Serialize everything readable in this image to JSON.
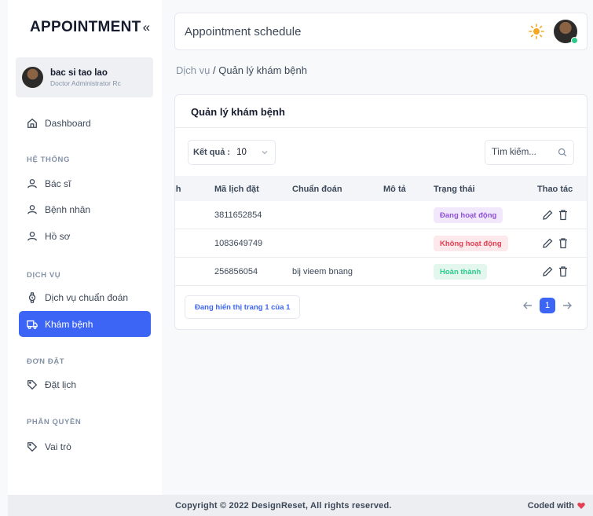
{
  "app": {
    "brand": "APPOINTMENT",
    "collapse_glyph": "«"
  },
  "profile": {
    "name": "bac si tao lao",
    "role": "Doctor Administrator Rc"
  },
  "nav": {
    "dashboard": "Dashboard",
    "section_system": "HỆ THỐNG",
    "doctors": "Bác sĩ",
    "patients": "Bệnh nhân",
    "records": "Hồ sơ",
    "section_services": "DỊCH VỤ",
    "diagnosis_service": "Dịch vụ chuẩn đoán",
    "examination": "Khám bệnh",
    "section_orders": "ĐƠN ĐẶT",
    "booking": "Đặt lịch",
    "section_permissions": "PHÂN QUYỀN",
    "roles": "Vai trò"
  },
  "topbar": {
    "search_placeholder": "Appointment schedule"
  },
  "breadcrumb": {
    "parent": "Dịch vụ",
    "separator": "/",
    "current": "Quản lý khám bệnh"
  },
  "card": {
    "title": "Quản lý khám bệnh",
    "results_label": "Kết quả :",
    "results_value": "10",
    "search_placeholder": "Tìm kiếm...",
    "columns": {
      "partial_first": "nh",
      "booking_code": "Mã lịch đặt",
      "diagnosis": "Chuẩn đoán",
      "description": "Mô tả",
      "status": "Trạng thái",
      "actions": "Thao tác"
    },
    "rows": [
      {
        "booking_code": "3811652854",
        "diagnosis": "",
        "description": "",
        "status": "Đang hoạt động",
        "status_color": "#8c4fd6"
      },
      {
        "booking_code": "1083649749",
        "diagnosis": "",
        "description": "",
        "status": "Không hoạt động",
        "status_color": "#e43f52"
      },
      {
        "booking_code": "256856054",
        "diagnosis": "bij vieem bnang",
        "description": "",
        "status": "Hoàn thành",
        "status_color": "#2eca8b"
      }
    ],
    "page_info": "Đang hiển thị trang 1 của 1",
    "current_page": "1"
  },
  "footer": {
    "copyright": "Copyright © 2022 DesignReset, All rights reserved.",
    "coded_with": "Coded with"
  },
  "colors": {
    "accent": "#3c65f5",
    "success": "#2eca8b",
    "danger": "#e43f52",
    "purple": "#8c4fd6"
  }
}
